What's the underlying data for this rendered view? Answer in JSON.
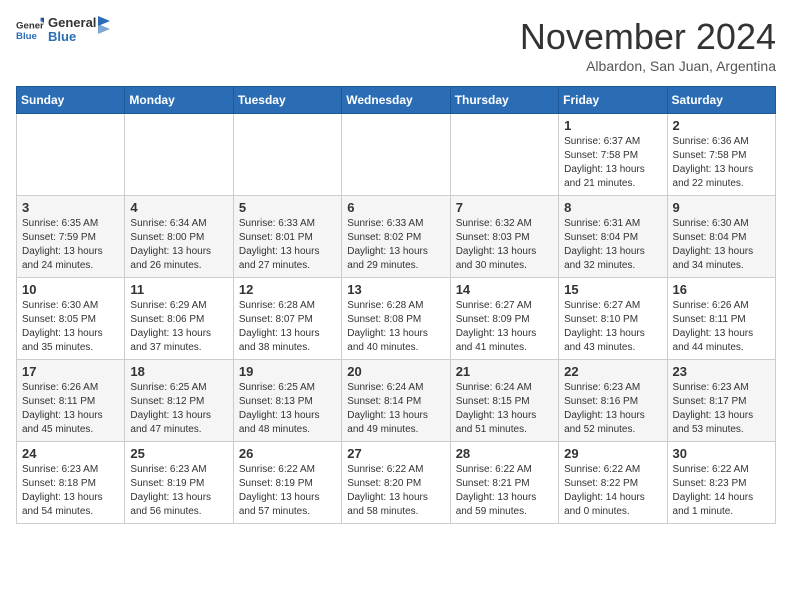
{
  "header": {
    "logo_general": "General",
    "logo_blue": "Blue",
    "month_title": "November 2024",
    "subtitle": "Albardon, San Juan, Argentina"
  },
  "weekdays": [
    "Sunday",
    "Monday",
    "Tuesday",
    "Wednesday",
    "Thursday",
    "Friday",
    "Saturday"
  ],
  "weeks": [
    [
      {
        "day": "",
        "info": ""
      },
      {
        "day": "",
        "info": ""
      },
      {
        "day": "",
        "info": ""
      },
      {
        "day": "",
        "info": ""
      },
      {
        "day": "",
        "info": ""
      },
      {
        "day": "1",
        "info": "Sunrise: 6:37 AM\nSunset: 7:58 PM\nDaylight: 13 hours\nand 21 minutes."
      },
      {
        "day": "2",
        "info": "Sunrise: 6:36 AM\nSunset: 7:58 PM\nDaylight: 13 hours\nand 22 minutes."
      }
    ],
    [
      {
        "day": "3",
        "info": "Sunrise: 6:35 AM\nSunset: 7:59 PM\nDaylight: 13 hours\nand 24 minutes."
      },
      {
        "day": "4",
        "info": "Sunrise: 6:34 AM\nSunset: 8:00 PM\nDaylight: 13 hours\nand 26 minutes."
      },
      {
        "day": "5",
        "info": "Sunrise: 6:33 AM\nSunset: 8:01 PM\nDaylight: 13 hours\nand 27 minutes."
      },
      {
        "day": "6",
        "info": "Sunrise: 6:33 AM\nSunset: 8:02 PM\nDaylight: 13 hours\nand 29 minutes."
      },
      {
        "day": "7",
        "info": "Sunrise: 6:32 AM\nSunset: 8:03 PM\nDaylight: 13 hours\nand 30 minutes."
      },
      {
        "day": "8",
        "info": "Sunrise: 6:31 AM\nSunset: 8:04 PM\nDaylight: 13 hours\nand 32 minutes."
      },
      {
        "day": "9",
        "info": "Sunrise: 6:30 AM\nSunset: 8:04 PM\nDaylight: 13 hours\nand 34 minutes."
      }
    ],
    [
      {
        "day": "10",
        "info": "Sunrise: 6:30 AM\nSunset: 8:05 PM\nDaylight: 13 hours\nand 35 minutes."
      },
      {
        "day": "11",
        "info": "Sunrise: 6:29 AM\nSunset: 8:06 PM\nDaylight: 13 hours\nand 37 minutes."
      },
      {
        "day": "12",
        "info": "Sunrise: 6:28 AM\nSunset: 8:07 PM\nDaylight: 13 hours\nand 38 minutes."
      },
      {
        "day": "13",
        "info": "Sunrise: 6:28 AM\nSunset: 8:08 PM\nDaylight: 13 hours\nand 40 minutes."
      },
      {
        "day": "14",
        "info": "Sunrise: 6:27 AM\nSunset: 8:09 PM\nDaylight: 13 hours\nand 41 minutes."
      },
      {
        "day": "15",
        "info": "Sunrise: 6:27 AM\nSunset: 8:10 PM\nDaylight: 13 hours\nand 43 minutes."
      },
      {
        "day": "16",
        "info": "Sunrise: 6:26 AM\nSunset: 8:11 PM\nDaylight: 13 hours\nand 44 minutes."
      }
    ],
    [
      {
        "day": "17",
        "info": "Sunrise: 6:26 AM\nSunset: 8:11 PM\nDaylight: 13 hours\nand 45 minutes."
      },
      {
        "day": "18",
        "info": "Sunrise: 6:25 AM\nSunset: 8:12 PM\nDaylight: 13 hours\nand 47 minutes."
      },
      {
        "day": "19",
        "info": "Sunrise: 6:25 AM\nSunset: 8:13 PM\nDaylight: 13 hours\nand 48 minutes."
      },
      {
        "day": "20",
        "info": "Sunrise: 6:24 AM\nSunset: 8:14 PM\nDaylight: 13 hours\nand 49 minutes."
      },
      {
        "day": "21",
        "info": "Sunrise: 6:24 AM\nSunset: 8:15 PM\nDaylight: 13 hours\nand 51 minutes."
      },
      {
        "day": "22",
        "info": "Sunrise: 6:23 AM\nSunset: 8:16 PM\nDaylight: 13 hours\nand 52 minutes."
      },
      {
        "day": "23",
        "info": "Sunrise: 6:23 AM\nSunset: 8:17 PM\nDaylight: 13 hours\nand 53 minutes."
      }
    ],
    [
      {
        "day": "24",
        "info": "Sunrise: 6:23 AM\nSunset: 8:18 PM\nDaylight: 13 hours\nand 54 minutes."
      },
      {
        "day": "25",
        "info": "Sunrise: 6:23 AM\nSunset: 8:19 PM\nDaylight: 13 hours\nand 56 minutes."
      },
      {
        "day": "26",
        "info": "Sunrise: 6:22 AM\nSunset: 8:19 PM\nDaylight: 13 hours\nand 57 minutes."
      },
      {
        "day": "27",
        "info": "Sunrise: 6:22 AM\nSunset: 8:20 PM\nDaylight: 13 hours\nand 58 minutes."
      },
      {
        "day": "28",
        "info": "Sunrise: 6:22 AM\nSunset: 8:21 PM\nDaylight: 13 hours\nand 59 minutes."
      },
      {
        "day": "29",
        "info": "Sunrise: 6:22 AM\nSunset: 8:22 PM\nDaylight: 14 hours\nand 0 minutes."
      },
      {
        "day": "30",
        "info": "Sunrise: 6:22 AM\nSunset: 8:23 PM\nDaylight: 14 hours\nand 1 minute."
      }
    ]
  ]
}
